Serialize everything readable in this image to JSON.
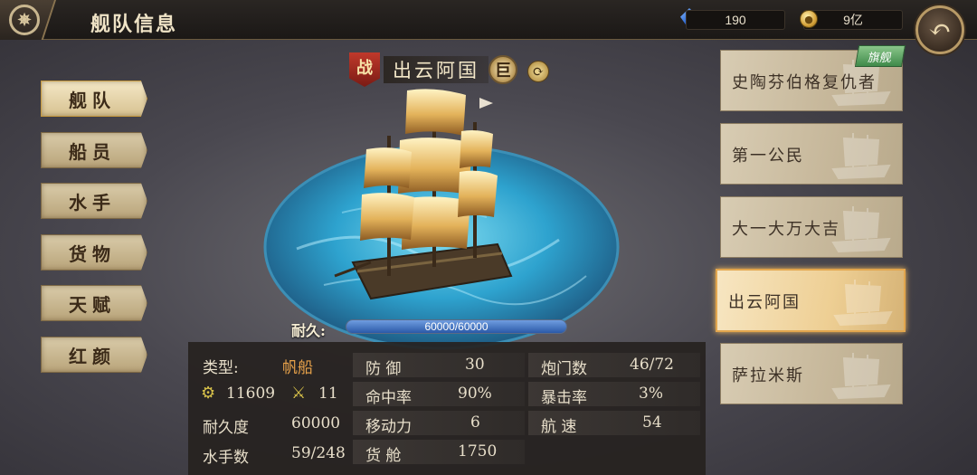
{
  "header": {
    "title": "舰队信息",
    "gems": "190",
    "gold": "9亿"
  },
  "menu": {
    "items": [
      "舰队",
      "船员",
      "水手",
      "货物",
      "天赋",
      "红颜"
    ],
    "active_index": 0
  },
  "ship": {
    "role_badge": "战",
    "name": "出云阿国",
    "size_badge": "巨",
    "durability_label": "耐久:",
    "durability_text": "60000/60000",
    "durability_fraction": 1.0
  },
  "stats": {
    "type_label": "类型:",
    "type_value": "帆船",
    "power_value": "11609",
    "crew_value": "11",
    "durability_label": "耐久度",
    "durability_value": "60000",
    "sailors_label": "水手数",
    "sailors_value": "59/248",
    "defense_label": "防 御",
    "defense_value": "30",
    "hit_label": "命中率",
    "hit_value": "90%",
    "mobility_label": "移动力",
    "mobility_value": "6",
    "cargo_label": "货 舱",
    "cargo_value": "1750",
    "cannon_label": "炮门数",
    "cannon_value": "46/72",
    "crit_label": "暴击率",
    "crit_value": "3%",
    "speed_label": "航 速",
    "speed_value": "54"
  },
  "fleet": {
    "flagship_badge": "旗舰",
    "ships": [
      "史陶芬伯格复仇者",
      "第一公民",
      "大一大万大吉",
      "出云阿国",
      "萨拉米斯"
    ],
    "selected_index": 3
  }
}
